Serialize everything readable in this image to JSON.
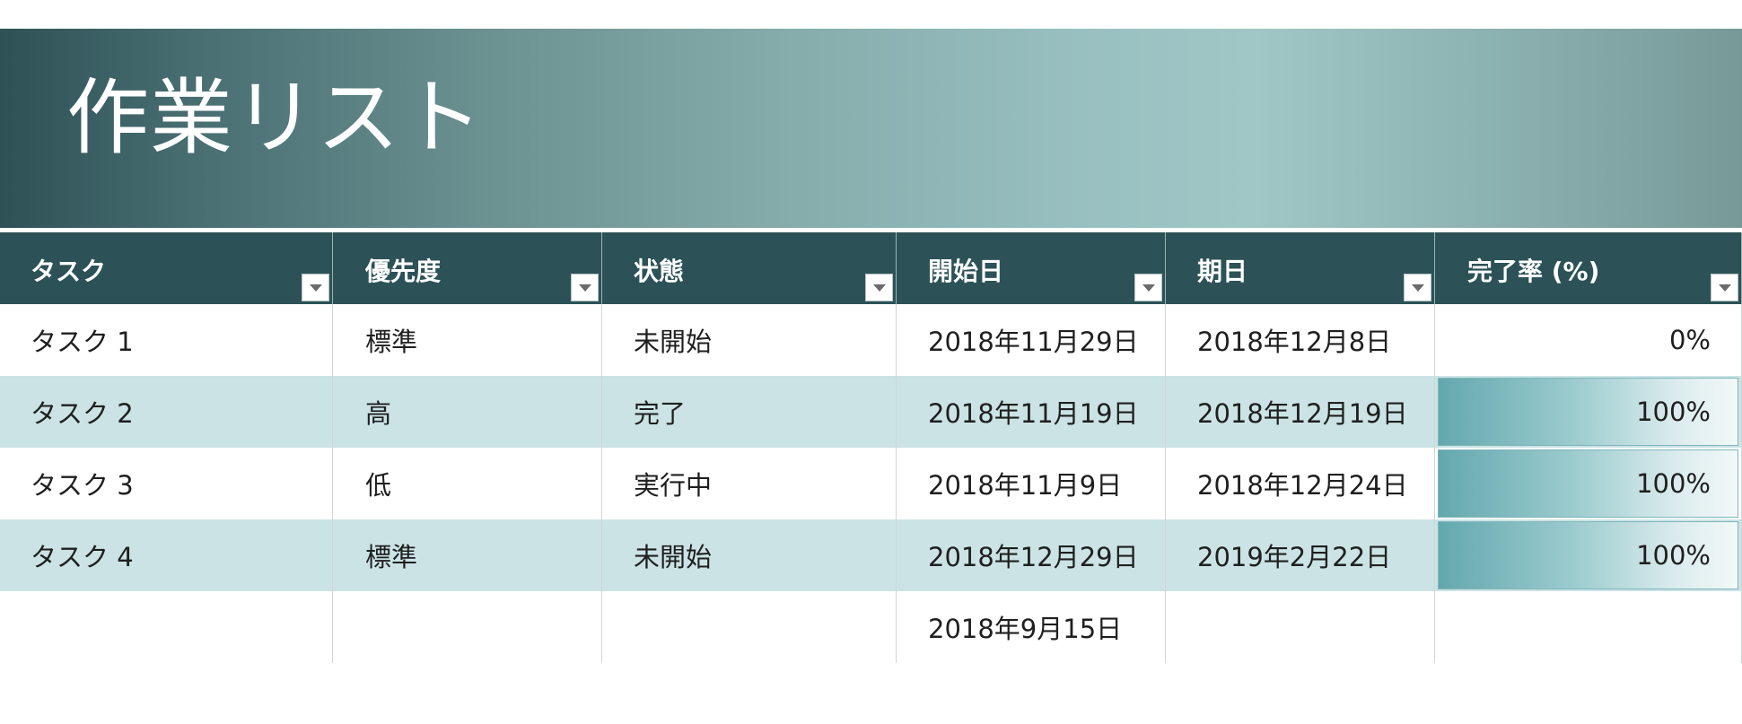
{
  "title": "作業リスト",
  "columns": [
    "タスク",
    "優先度",
    "状態",
    "開始日",
    "期日",
    "完了率 (%)"
  ],
  "rows": [
    {
      "task": "タスク 1",
      "priority": "標準",
      "status": "未開始",
      "start": "2018年11月29日",
      "due": "2018年12月8日",
      "pct_label": "0%",
      "pct": 0
    },
    {
      "task": "タスク 2",
      "priority": "高",
      "status": "完了",
      "start": "2018年11月19日",
      "due": "2018年12月19日",
      "pct_label": "100%",
      "pct": 1.0
    },
    {
      "task": "タスク 3",
      "priority": "低",
      "status": "実行中",
      "start": "2018年11月9日",
      "due": "2018年12月24日",
      "pct_label": "100%",
      "pct": 1.0
    },
    {
      "task": "タスク 4",
      "priority": "標準",
      "status": "未開始",
      "start": "2018年12月29日",
      "due": "2019年2月22日",
      "pct_label": "100%",
      "pct": 1.0
    },
    {
      "task": "",
      "priority": "",
      "status": "",
      "start": "2018年9月15日",
      "due": "",
      "pct_label": "",
      "pct": null
    }
  ],
  "colors": {
    "header_bg": "#2c5257",
    "band_bg": "#cbe3e5",
    "bar_start": "#63a8ae",
    "bar_end": "#f2f8f8"
  },
  "icons": {
    "filter": "filter-dropdown-icon"
  }
}
